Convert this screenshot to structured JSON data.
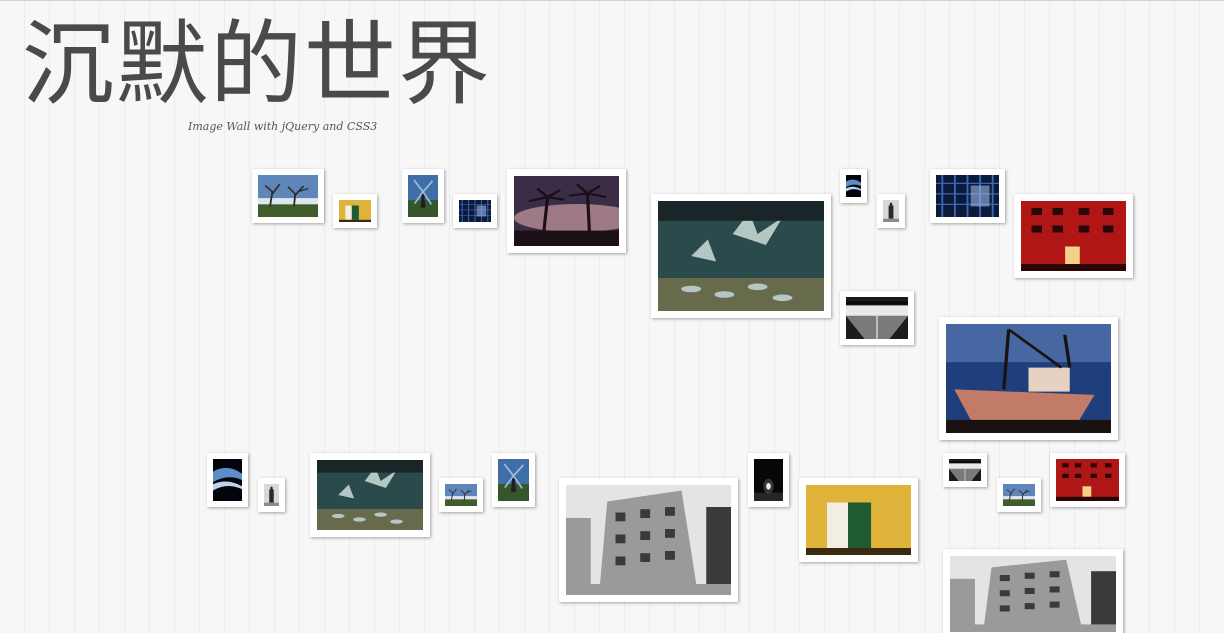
{
  "header": {
    "title": "沉默的世界",
    "subtitle": "Image Wall with jQuery and CSS3"
  },
  "photos": [
    {
      "name": "photo-trees-beach",
      "scene": "trees",
      "colors": [
        "#5f86b8",
        "#dfe6ee",
        "#3f5e2a",
        "#2a2a2a"
      ]
    },
    {
      "name": "photo-yellow-door-small",
      "scene": "door",
      "colors": [
        "#e0b43a",
        "#1f5a30",
        "#f2efe2",
        "#3a2a10"
      ]
    },
    {
      "name": "photo-windmill-small",
      "scene": "windmill",
      "colors": [
        "#3f6ea8",
        "#9cbbd8",
        "#35562a",
        "#1e1e1e"
      ]
    },
    {
      "name": "photo-blue-grid-small",
      "scene": "grid",
      "colors": [
        "#0b1a3a",
        "#3c66b0",
        "#9bb8e8",
        "#0a0a12"
      ]
    },
    {
      "name": "photo-palm-sunset",
      "scene": "palms",
      "colors": [
        "#3b2d47",
        "#c89ba0",
        "#1a1015",
        "#e9c8a8"
      ]
    },
    {
      "name": "photo-pigeons-large",
      "scene": "pigeons",
      "colors": [
        "#2b4a4c",
        "#b4c7c4",
        "#1a2527",
        "#d6a84a"
      ]
    },
    {
      "name": "photo-blue-tunnel-tiny",
      "scene": "tunnel",
      "colors": [
        "#0a1830",
        "#5d8ec8",
        "#b9d3f0",
        "#02060c"
      ]
    },
    {
      "name": "photo-dark-figure-tiny",
      "scene": "figure",
      "colors": [
        "#d8d8d8",
        "#2a2a2a",
        "#8a8a8a",
        "#101010"
      ]
    },
    {
      "name": "photo-blue-grid",
      "scene": "grid",
      "colors": [
        "#0b1a3a",
        "#3c66b0",
        "#9bb8e8",
        "#0a0a12"
      ]
    },
    {
      "name": "photo-red-building",
      "scene": "redbuilding",
      "colors": [
        "#b01616",
        "#ff4a3a",
        "#2a0606",
        "#f4d088"
      ]
    },
    {
      "name": "photo-bw-pier",
      "scene": "pier",
      "colors": [
        "#1b1b1b",
        "#e9e9e9",
        "#7a7a7a",
        "#0c0c0c"
      ]
    },
    {
      "name": "photo-boat-dusk",
      "scene": "boat",
      "colors": [
        "#1f3e7c",
        "#6d8fc8",
        "#1a1210",
        "#c27b66"
      ]
    },
    {
      "name": "photo-blue-tunnel",
      "scene": "tunnel",
      "colors": [
        "#0a1830",
        "#5d8ec8",
        "#b9d3f0",
        "#02060c"
      ]
    },
    {
      "name": "photo-dark-figure",
      "scene": "figure",
      "colors": [
        "#d8d8d8",
        "#2a2a2a",
        "#8a8a8a",
        "#101010"
      ]
    },
    {
      "name": "photo-pigeons",
      "scene": "pigeons",
      "colors": [
        "#2b4a4c",
        "#b4c7c4",
        "#1a2527",
        "#d6a84a"
      ]
    },
    {
      "name": "photo-trees-beach-small",
      "scene": "trees",
      "colors": [
        "#5f86b8",
        "#dfe6ee",
        "#3f5e2a",
        "#2a2a2a"
      ]
    },
    {
      "name": "photo-windmill",
      "scene": "windmill",
      "colors": [
        "#3f6ea8",
        "#9cbbd8",
        "#35562a",
        "#1e1e1e"
      ]
    },
    {
      "name": "photo-bw-building",
      "scene": "building",
      "colors": [
        "#e4e4e4",
        "#3a3a3a",
        "#9a9a9a",
        "#151515"
      ]
    },
    {
      "name": "photo-night-light",
      "scene": "night",
      "colors": [
        "#070707",
        "#eaeaea",
        "#555555",
        "#000000"
      ]
    },
    {
      "name": "photo-yellow-door",
      "scene": "door",
      "colors": [
        "#e0b43a",
        "#1f5a30",
        "#f2efe2",
        "#3a2a10"
      ]
    },
    {
      "name": "photo-bw-pier-small",
      "scene": "pier",
      "colors": [
        "#1b1b1b",
        "#e9e9e9",
        "#7a7a7a",
        "#0c0c0c"
      ]
    },
    {
      "name": "photo-trees-beach-tiny",
      "scene": "trees",
      "colors": [
        "#5f86b8",
        "#dfe6ee",
        "#3f5e2a",
        "#2a2a2a"
      ]
    },
    {
      "name": "photo-red-building-small",
      "scene": "redbuilding",
      "colors": [
        "#b01616",
        "#ff4a3a",
        "#2a0606",
        "#f4d088"
      ]
    },
    {
      "name": "photo-bw-building-large",
      "scene": "building",
      "colors": [
        "#e4e4e4",
        "#3a3a3a",
        "#9a9a9a",
        "#151515"
      ]
    }
  ]
}
